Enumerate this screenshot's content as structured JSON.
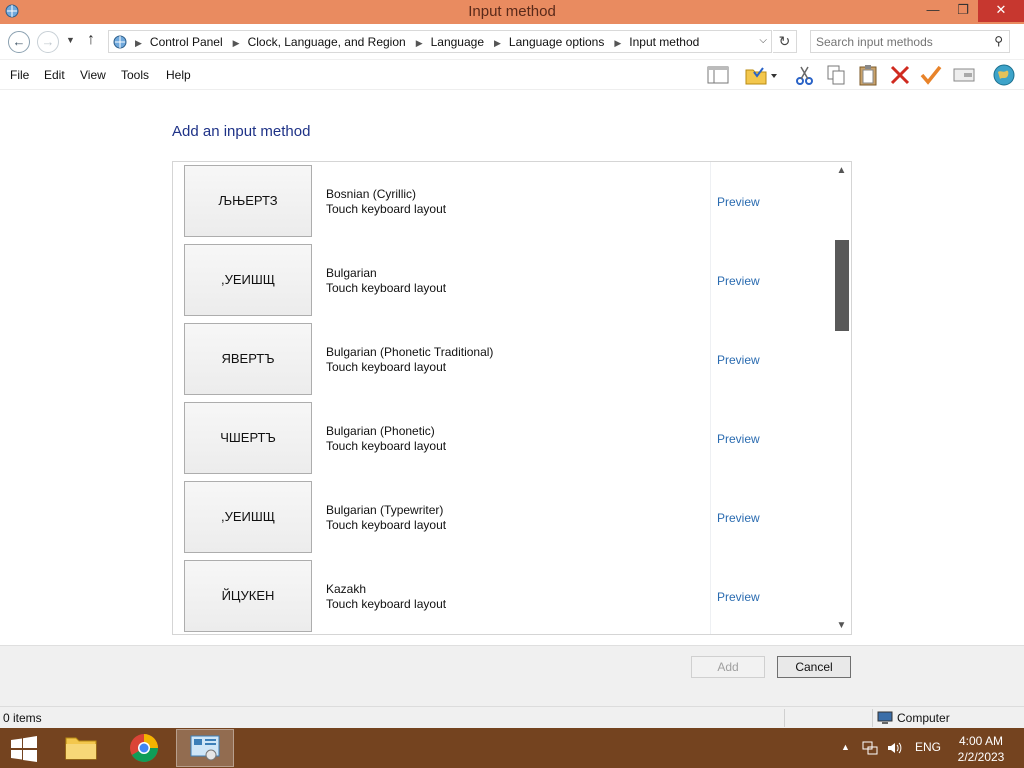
{
  "window": {
    "title": "Input method",
    "min_glyph": "—",
    "max_glyph": "❐",
    "close_glyph": "✕"
  },
  "address_bar": {
    "breadcrumbs": [
      "Control Panel",
      "Clock, Language, and Region",
      "Language",
      "Language options",
      "Input method"
    ],
    "search_placeholder": "Search input methods"
  },
  "menu": {
    "items": [
      "File",
      "Edit",
      "View",
      "Tools",
      "Help"
    ]
  },
  "toolbar": {
    "icons": [
      "layout-pane-icon",
      "folder-check-icon",
      "cut-icon",
      "copy-icon",
      "paste-icon",
      "delete-icon",
      "checkmark-icon",
      "properties-icon",
      "globe-icon"
    ]
  },
  "main": {
    "heading": "Add an input method",
    "items": [
      {
        "key_label": "ЉЊЕРТЗ",
        "name": "Bosnian (Cyrillic)",
        "type": "Touch keyboard layout",
        "preview": "Preview"
      },
      {
        "key_label": ",УЕИШЩ",
        "name": "Bulgarian",
        "type": "Touch keyboard layout",
        "preview": "Preview"
      },
      {
        "key_label": "ЯВЕРТЪ",
        "name": "Bulgarian (Phonetic Traditional)",
        "type": "Touch keyboard layout",
        "preview": "Preview"
      },
      {
        "key_label": "ЧШЕРТЪ",
        "name": "Bulgarian (Phonetic)",
        "type": "Touch keyboard layout",
        "preview": "Preview"
      },
      {
        "key_label": ",УЕИШЩ",
        "name": "Bulgarian (Typewriter)",
        "type": "Touch keyboard layout",
        "preview": "Preview"
      },
      {
        "key_label": "ЙЦУКЕН",
        "name": "Kazakh",
        "type": "Touch keyboard layout",
        "preview": "Preview"
      }
    ]
  },
  "buttons": {
    "add": "Add",
    "cancel": "Cancel"
  },
  "statusbar": {
    "items_count": "0 items",
    "location": "Computer"
  },
  "taskbar": {
    "tray_lang": "ENG",
    "time": "4:00 AM",
    "date": "2/2/2023"
  },
  "colors": {
    "titlebar": "#e98b60",
    "taskbar": "#74431f",
    "link": "#2a6bb0",
    "heading": "#1e3287"
  }
}
